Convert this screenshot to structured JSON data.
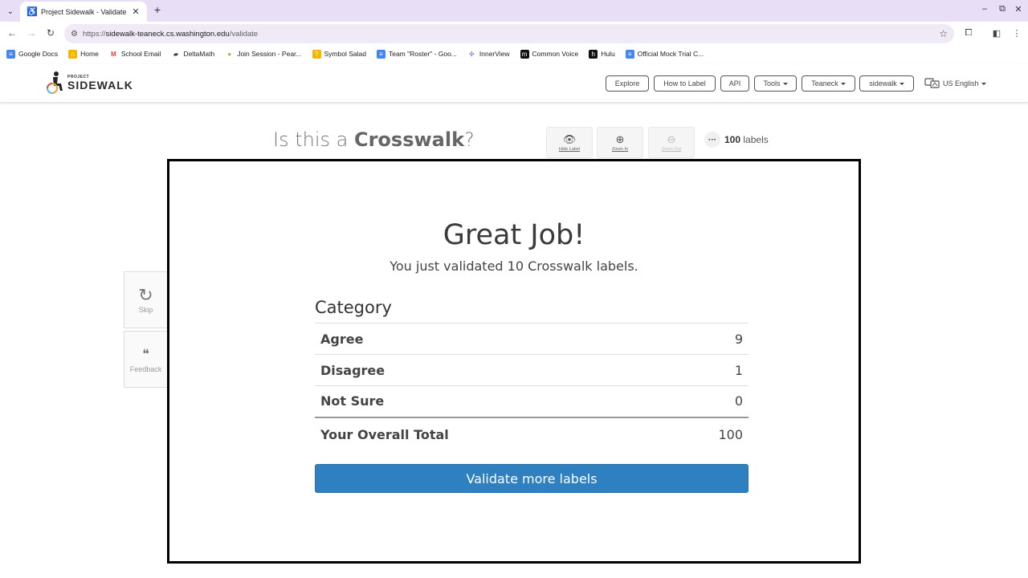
{
  "browser": {
    "tab_title": "Project Sidewalk - Validate",
    "new_tab": "+",
    "url_scheme": "https://",
    "url_host": "sidewalk-teaneck.cs.washington.edu",
    "url_path": "/validate",
    "bookmarks": [
      {
        "label": "Google Docs",
        "icon": "docs-icon",
        "color": "#4285f4"
      },
      {
        "label": "Home",
        "icon": "home-icon",
        "color": "#f4b400"
      },
      {
        "label": "School Email",
        "icon": "gmail-icon",
        "color": "#ea4335"
      },
      {
        "label": "DeltaMath",
        "icon": "deltamath-icon",
        "color": "#333333"
      },
      {
        "label": "Join Session - Pear...",
        "icon": "pear-icon",
        "color": "#8bc34a"
      },
      {
        "label": "Symbol Salad",
        "icon": "symbol-salad-icon",
        "color": "#f4b400"
      },
      {
        "label": "Team \"Roster\" - Goo...",
        "icon": "docs-icon",
        "color": "#4285f4"
      },
      {
        "label": "InnerView",
        "icon": "innerview-icon",
        "color": "#7b4fc8"
      },
      {
        "label": "Common Voice",
        "icon": "commonvoice-icon",
        "color": "#111111"
      },
      {
        "label": "Hulu",
        "icon": "hulu-icon",
        "color": "#111111"
      },
      {
        "label": "Official Mock Trial C...",
        "icon": "docs-icon",
        "color": "#4285f4"
      }
    ]
  },
  "header": {
    "logo_small": "PROJECT",
    "logo_big": "SIDEWALK",
    "nav": [
      {
        "label": "Explore",
        "dropdown": false
      },
      {
        "label": "How to Label",
        "dropdown": false
      },
      {
        "label": "API",
        "dropdown": false
      },
      {
        "label": "Tools",
        "dropdown": true
      },
      {
        "label": "Teaneck",
        "dropdown": true
      },
      {
        "label": "sidewalk",
        "dropdown": true
      }
    ],
    "language": "US English"
  },
  "validate": {
    "question_prefix": "Is this a ",
    "question_label_type": "Crosswalk",
    "question_suffix": "?",
    "tools": {
      "hide_label": "Hide Label",
      "zoom_in": "Zoom In",
      "zoom_out": "Zoom Out"
    },
    "more": "···",
    "label_count": "100",
    "label_count_unit": "labels",
    "skip": "Skip",
    "feedback": "Feedback"
  },
  "modal": {
    "title": "Great Job!",
    "subtitle": "You just validated 10 Crosswalk labels.",
    "category_heading": "Category",
    "rows": [
      {
        "label": "Agree",
        "value": "9"
      },
      {
        "label": "Disagree",
        "value": "1"
      },
      {
        "label": "Not Sure",
        "value": "0"
      }
    ],
    "total_label": "Your Overall Total",
    "total_value": "100",
    "button_label": "Validate more labels",
    "button_color": "#2f80c1"
  }
}
